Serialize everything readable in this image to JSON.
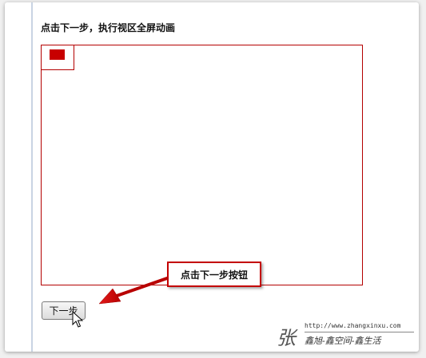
{
  "page": {
    "heading": "点击下一步，执行视区全屏动画"
  },
  "annotation": {
    "callout_text": "点击下一步按钮"
  },
  "controls": {
    "next_button_label": "下一步"
  },
  "watermark": {
    "glyph": "张",
    "url": "http://www.zhangxinxu.com",
    "name": "鑫旭-鑫空间-鑫生活"
  },
  "colors": {
    "accent_red": "#c80000",
    "border_red": "#b40000",
    "guide_line": "#c9d4e3"
  }
}
